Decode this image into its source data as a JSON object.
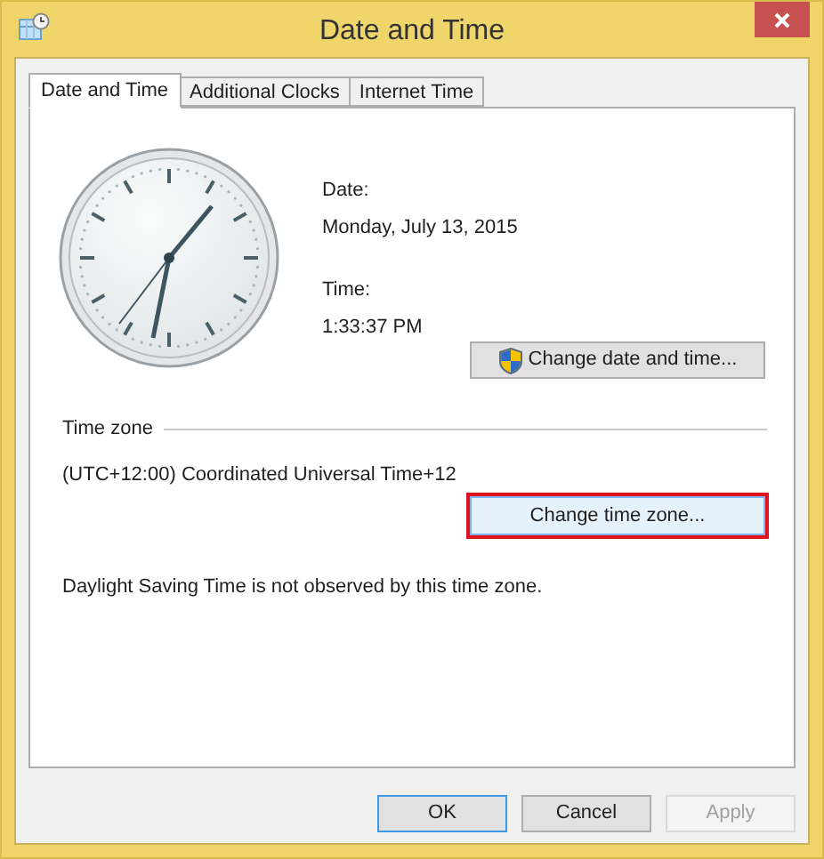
{
  "window": {
    "title": "Date and Time"
  },
  "tabs": [
    {
      "label": "Date and Time",
      "selected": true
    },
    {
      "label": "Additional Clocks",
      "selected": false
    },
    {
      "label": "Internet Time",
      "selected": false
    }
  ],
  "date": {
    "label": "Date:",
    "value": "Monday, July 13, 2015"
  },
  "time": {
    "label": "Time:",
    "value": "1:33:37 PM"
  },
  "change_date_button": {
    "label": "Change date and time..."
  },
  "time_zone": {
    "heading": "Time zone",
    "value": "(UTC+12:00) Coordinated Universal Time+12"
  },
  "change_zone_button": {
    "label": "Change time zone...",
    "highlighted": true
  },
  "dst_note": "Daylight Saving Time is not observed by this time zone.",
  "buttons": [
    {
      "label": "OK",
      "default": true,
      "disabled": false
    },
    {
      "label": "Cancel",
      "default": false,
      "disabled": false
    },
    {
      "label": "Apply",
      "default": false,
      "disabled": true
    }
  ]
}
